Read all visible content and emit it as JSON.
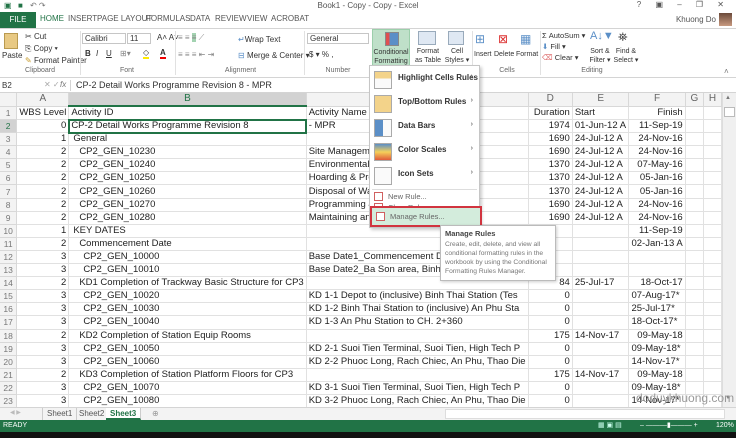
{
  "window": {
    "title": "Book1 - Copy - Copy - Excel",
    "user": "Khuong Do",
    "controls": "? ▣ – ❐ ✕"
  },
  "tabs": [
    "FILE",
    "HOME",
    "INSERT",
    "PAGE LAYOUT",
    "FORMULAS",
    "DATA",
    "REVIEW",
    "VIEW",
    "ACROBAT"
  ],
  "ribbon": {
    "clipboard": {
      "paste": "Paste",
      "cut": "Cut",
      "copy": "Copy ▾",
      "format_painter": "Format Painter",
      "label": "Clipboard"
    },
    "font": {
      "name": "Calibri",
      "size": "11",
      "label": "Font",
      "bold": "B",
      "italic": "I",
      "underline": "U"
    },
    "alignment": {
      "wrap": "Wrap Text",
      "merge": "Merge & Center ▾",
      "label": "Alignment"
    },
    "number": {
      "format": "General",
      "currency": "$ ▾ % ,",
      "label": "Number"
    },
    "styles": {
      "conditional": "Conditional Formatting ▾",
      "format_table": "Format as Table ▾",
      "cell_styles": "Cell Styles ▾"
    },
    "cells": {
      "insert": "Insert",
      "delete": "Delete",
      "format": "Format",
      "label": "Cells"
    },
    "editing": {
      "autosum": "Σ AutoSum ▾",
      "fill": "Fill ▾",
      "clear": "Clear ▾",
      "sort": "Sort & Filter ▾",
      "find": "Find & Select ▾",
      "label": "Editing"
    }
  },
  "formula_bar": {
    "name_box": "B2",
    "fx": "fx",
    "formula": "CP-2 Detail Works Programme Revision 8 - MPR"
  },
  "columns": [
    "A",
    "B",
    "C",
    "D",
    "E",
    "F",
    "G",
    "H"
  ],
  "rows": [
    {
      "n": "1",
      "a": "WBS Level",
      "b": "Activity ID",
      "c": "Activity Name",
      "d": "Duration",
      "e": "Start",
      "f": "Finish",
      "lvl": 0
    },
    {
      "n": "2",
      "a": "0",
      "b": "CP-2 Detail Works Programme Revision 8",
      "c": "- MPR",
      "d": "1974",
      "e": "01-Jun-12 A",
      "f": "11-Sep-19",
      "lvl": 0
    },
    {
      "n": "3",
      "a": "1",
      "b": "General",
      "c": "",
      "d": "1690",
      "e": "24-Jul-12 A",
      "f": "24-Nov-16",
      "lvl": 1
    },
    {
      "n": "4",
      "a": "2",
      "b": "CP2_GEN_10230",
      "c": "Site Management",
      "d": "1690",
      "e": "24-Jul-12 A",
      "f": "24-Nov-16",
      "lvl": 2
    },
    {
      "n": "5",
      "a": "2",
      "b": "CP2_GEN_10240",
      "c": "Environmental Safety Health and",
      "d": "1370",
      "e": "24-Jul-12 A",
      "f": "07-May-16",
      "lvl": 2
    },
    {
      "n": "6",
      "a": "2",
      "b": "CP2_GEN_10250",
      "c": "Hoarding & Project Signboard",
      "d": "1370",
      "e": "24-Jul-12 A",
      "f": "05-Jan-16",
      "lvl": 2
    },
    {
      "n": "7",
      "a": "2",
      "b": "CP2_GEN_10260",
      "c": "Disposal of Waste Material",
      "d": "1370",
      "e": "24-Jul-12 A",
      "f": "05-Jan-16",
      "lvl": 2
    },
    {
      "n": "8",
      "a": "2",
      "b": "CP2_GEN_10270",
      "c": "Programming & Planning",
      "d": "1690",
      "e": "24-Jul-12 A",
      "f": "24-Nov-16",
      "lvl": 2
    },
    {
      "n": "9",
      "a": "2",
      "b": "CP2_GEN_10280",
      "c": "Maintaining and Servicing Facilit",
      "d": "1690",
      "e": "24-Jul-12 A",
      "f": "24-Nov-16",
      "lvl": 2
    },
    {
      "n": "10",
      "a": "1",
      "b": "KEY DATES",
      "c": "",
      "d": "",
      "e": "",
      "f": "11-Sep-19",
      "lvl": 1
    },
    {
      "n": "11",
      "a": "2",
      "b": "Commencement Date",
      "c": "",
      "d": "",
      "e": "",
      "f": "02-Jan-13 A",
      "lvl": 2
    },
    {
      "n": "12",
      "a": "3",
      "b": "CP2_GEN_10000",
      "c": "Base Date1_Commencement Date",
      "d": "",
      "e": "",
      "f": "",
      "lvl": 3
    },
    {
      "n": "13",
      "a": "3",
      "b": "CP2_GEN_10010",
      "c": "Base Date2_Ba Son area, Binh Duong Province, re",
      "d": "",
      "e": "",
      "f": "",
      "lvl": 3
    },
    {
      "n": "14",
      "a": "2",
      "b": "KD1 Completion of Trackway Basic Structure for CP3",
      "c": "",
      "d": "84",
      "e": "25-Jul-17",
      "f": "18-Oct-17",
      "lvl": 2
    },
    {
      "n": "15",
      "a": "3",
      "b": "CP2_GEN_10020",
      "c": "KD 1-1 Depot to (inclusive) Binh Thai Station (Tes",
      "d": "0",
      "e": "",
      "f": "07-Aug-17*",
      "lvl": 3
    },
    {
      "n": "16",
      "a": "3",
      "b": "CP2_GEN_10030",
      "c": "KD 1-2 Binh Thai Station to (inclusive) An Phu Sta",
      "d": "0",
      "e": "",
      "f": "25-Jul-17*",
      "lvl": 3
    },
    {
      "n": "17",
      "a": "3",
      "b": "CP2_GEN_10040",
      "c": "KD 1-3 An Phu Station to CH. 2+360",
      "d": "0",
      "e": "",
      "f": "18-Oct-17*",
      "lvl": 3
    },
    {
      "n": "18",
      "a": "2",
      "b": "KD2 Completion of Station Equip Rooms",
      "c": "",
      "d": "175",
      "e": "14-Nov-17",
      "f": "09-May-18",
      "lvl": 2
    },
    {
      "n": "19",
      "a": "3",
      "b": "CP2_GEN_10050",
      "c": "KD 2-1 Suoi Tien Terminal, Suoi Tien, High Tech P",
      "d": "0",
      "e": "",
      "f": "09-May-18*",
      "lvl": 3
    },
    {
      "n": "20",
      "a": "3",
      "b": "CP2_GEN_10060",
      "c": "KD 2-2 Phuoc Long, Rach Chiec, An Phu, Thao Die",
      "d": "0",
      "e": "",
      "f": "14-Nov-17*",
      "lvl": 3
    },
    {
      "n": "21",
      "a": "2",
      "b": "KD3 Completion of Station Platform Floors for CP3",
      "c": "",
      "d": "175",
      "e": "14-Nov-17",
      "f": "09-May-18",
      "lvl": 2
    },
    {
      "n": "22",
      "a": "3",
      "b": "CP2_GEN_10070",
      "c": "KD 3-1 Suoi Tien Terminal, Suoi Tien, High Tech P",
      "d": "0",
      "e": "",
      "f": "09-May-18*",
      "lvl": 3
    },
    {
      "n": "23",
      "a": "3",
      "b": "CP2_GEN_10080",
      "c": "KD 3-2 Phuoc Long, Rach Chiec, An Phu, Thao Die",
      "d": "0",
      "e": "",
      "f": "14-Nov-17*",
      "lvl": 3
    }
  ],
  "menu": {
    "items": [
      "Highlight Cells Rules",
      "Top/Bottom Rules",
      "Data Bars",
      "Color Scales",
      "Icon Sets"
    ],
    "new_rule": "New Rule...",
    "clear_rules": "Clear Rules",
    "manage_rules": "Manage Rules..."
  },
  "tooltip": {
    "title": "Manage Rules",
    "body": "Create, edit, delete, and view all conditional formatting rules in the workbook by using the Conditional Formatting Rules Manager."
  },
  "sheets": [
    "Sheet1",
    "Sheet2",
    "Sheet3"
  ],
  "active_sheet": "Sheet3",
  "status": {
    "mode": "READY",
    "zoom": "120%"
  },
  "watermark": "doduykhuong.com",
  "colors": {
    "accent": "#217346",
    "highlight": "#d3ecdc",
    "red_box": "#d1343f"
  }
}
